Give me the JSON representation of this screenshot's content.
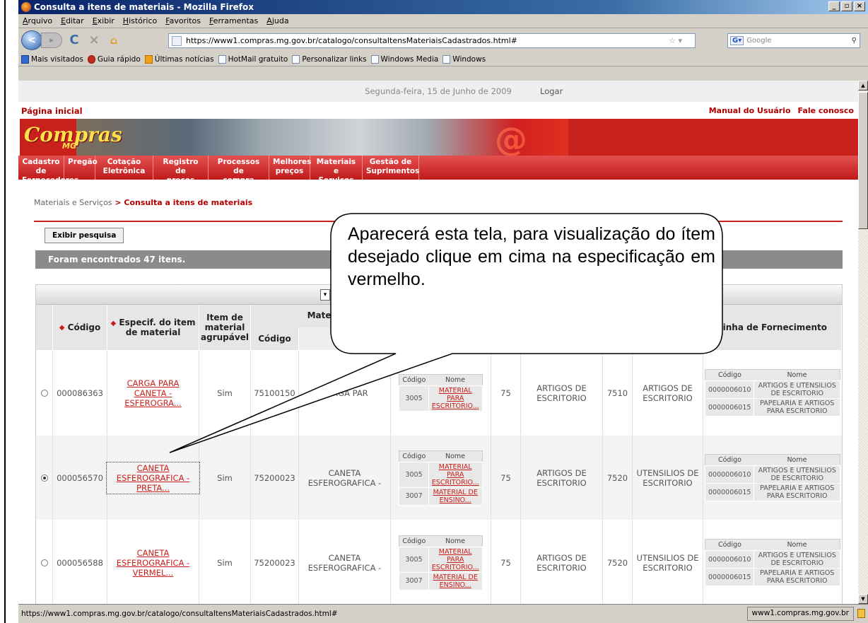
{
  "window": {
    "title": "Consulta a itens de materiais - Mozilla Firefox"
  },
  "menu": [
    "Arquivo",
    "Editar",
    "Exibir",
    "Histórico",
    "Favoritos",
    "Ferramentas",
    "Ajuda"
  ],
  "url": "https://www1.compras.mg.gov.br/catalogo/consultaItensMateriaisCadastrados.html#",
  "search_engine": "Google",
  "bookmarks": [
    "Mais visitados",
    "Guia rápido",
    "Últimas notícias",
    "HotMail gratuito",
    "Personalizar links",
    "Windows Media",
    "Windows"
  ],
  "site": {
    "date": "Segunda-feira, 15 de Junho de 2009",
    "login": "Logar",
    "home": "Página inicial",
    "manual": "Manual do Usuário",
    "contact": "Fale conosco",
    "logo": "Compras",
    "logo_sub": "MG",
    "nav": [
      [
        "Cadastro de",
        "Fornecedores"
      ],
      [
        "Pregão",
        ""
      ],
      [
        "Cotação",
        "Eletrônica"
      ],
      [
        "Registro de",
        "preços"
      ],
      [
        "Processos de",
        "compra"
      ],
      [
        "Melhores",
        "preços"
      ],
      [
        "Materiais e",
        "Serviços"
      ],
      [
        "Gestão de",
        "Suprimentos"
      ]
    ]
  },
  "breadcrumb": {
    "parent": "Materiais e Serviços",
    "sep": " > ",
    "current": "Consulta a itens de materiais"
  },
  "show_search": "Exibir pesquisa",
  "found": "Foram encontrados 47 itens.",
  "headers": {
    "code": "Código",
    "spec": "Especif. do item de material",
    "grouped": "Item de material agrupável",
    "material": "Mater",
    "mat_code": "Código",
    "supply": "Linha de Fornecimento",
    "code_small": "Código",
    "name_small": "Nome"
  },
  "rows": [
    {
      "code": "000086363",
      "spec": "CARGA PARA CANETA - ESFEROGRA...",
      "grouped": "Sim",
      "mat_code": "75100150",
      "mat_name": "CARGA PAR",
      "cls": [
        [
          "3005",
          "MATERIAL PARA ESCRITORIO..."
        ]
      ],
      "grp": "75",
      "grp_name": "ARTIGOS DE ESCRITORIO",
      "sub": "7510",
      "sub_name": "ARTIGOS DE ESCRITORIO",
      "lines": [
        [
          "0000006010",
          "ARTIGOS E UTENSILIOS DE ESCRITORIO"
        ],
        [
          "0000006015",
          "PAPELARIA E ARTIGOS PARA ESCRITORIO"
        ]
      ],
      "selected": false
    },
    {
      "code": "000056570",
      "spec": "CANETA ESFEROGRAFICA - PRETA...",
      "grouped": "Sim",
      "mat_code": "75200023",
      "mat_name": "CANETA ESFEROGRAFICA -",
      "cls": [
        [
          "3005",
          "MATERIAL PARA ESCRITORIO..."
        ],
        [
          "3007",
          "MATERIAL DE ENSINO..."
        ]
      ],
      "grp": "75",
      "grp_name": "ARTIGOS DE ESCRITORIO",
      "sub": "7520",
      "sub_name": "UTENSILIOS DE ESCRITORIO",
      "lines": [
        [
          "0000006010",
          "ARTIGOS E UTENSILIOS DE ESCRITORIO"
        ],
        [
          "0000006015",
          "PAPELARIA E ARTIGOS PARA ESCRITORIO"
        ]
      ],
      "selected": true
    },
    {
      "code": "000056588",
      "spec": "CANETA ESFEROGRAFICA - VERMEL...",
      "grouped": "Sim",
      "mat_code": "75200023",
      "mat_name": "CANETA ESFEROGRAFICA -",
      "cls": [
        [
          "3005",
          "MATERIAL PARA ESCRITORIO..."
        ],
        [
          "3007",
          "MATERIAL DE ENSINO..."
        ]
      ],
      "grp": "75",
      "grp_name": "ARTIGOS DE ESCRITORIO",
      "sub": "7520",
      "sub_name": "UTENSILIOS DE ESCRITORIO",
      "lines": [
        [
          "0000006010",
          "ARTIGOS E UTENSILIOS DE ESCRITORIO"
        ],
        [
          "0000006015",
          "PAPELARIA E ARTIGOS PARA ESCRITORIO"
        ]
      ],
      "selected": false
    }
  ],
  "callout": "Aparecerá esta tela, para visualização do ítem desejado clique em cima na especificação em vermelho.",
  "status": {
    "url": "https://www1.compras.mg.gov.br/catalogo/consultaItensMateriaisCadastrados.html#",
    "host": "www1.compras.mg.gov.br"
  },
  "colors": {
    "brand_red": "#c8201a",
    "title_blue": "#0a246a"
  }
}
